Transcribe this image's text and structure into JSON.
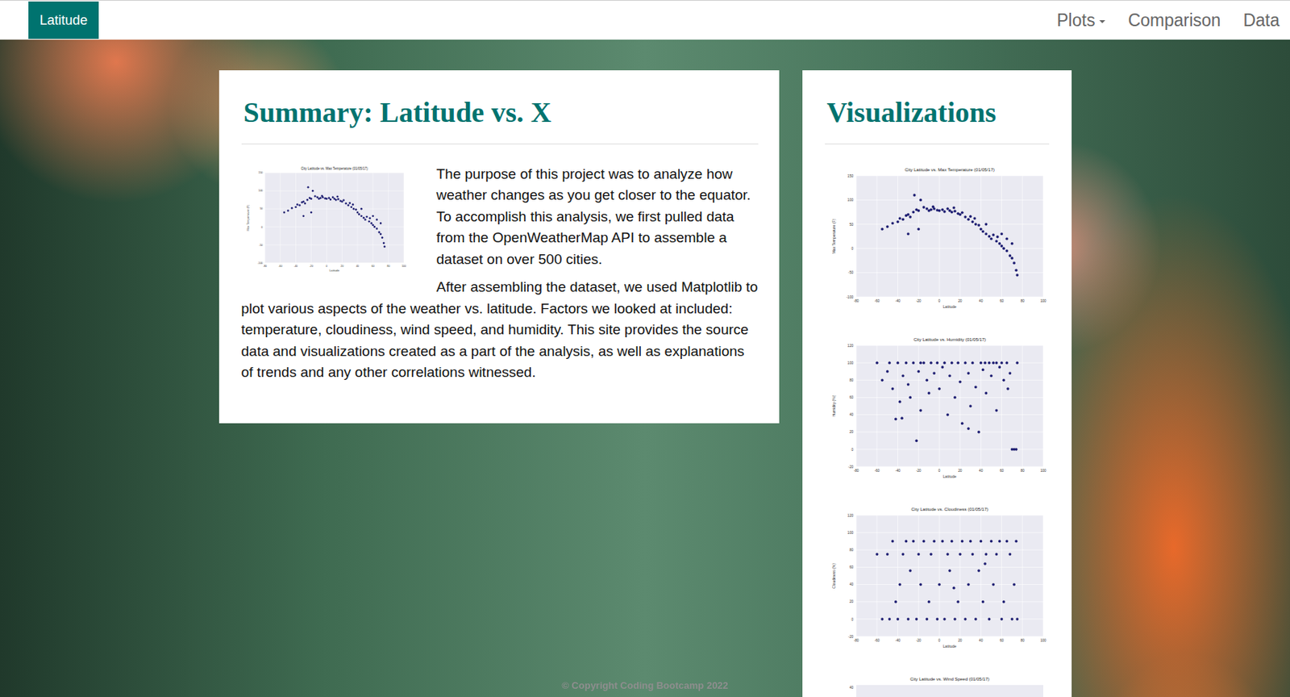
{
  "navbar": {
    "brand": "Latitude",
    "links": [
      {
        "label": "Plots",
        "dropdown": true
      },
      {
        "label": "Comparison",
        "dropdown": false
      },
      {
        "label": "Data",
        "dropdown": false
      }
    ]
  },
  "summary": {
    "title": "Summary: Latitude vs. X",
    "paragraphs": [
      "The purpose of this project was to analyze how weather changes as you get closer to the equator. To accomplish this analysis, we first pulled data from the OpenWeatherMap API to assemble a dataset on over 500 cities.",
      "After assembling the dataset, we used Matplotlib to plot various aspects of the weather vs. latitude. Factors we looked at included: temperature, cloudiness, wind speed, and humidity. This site provides the source data and visualizations created as a part of the analysis, as well as explanations of trends and any other correlations witnessed."
    ]
  },
  "visualizations": {
    "title": "Visualizations",
    "charts": [
      {
        "kind": "full",
        "title": "City Latitude vs. Max Temperature (01/05/17)",
        "x_label": "Latitude",
        "y_label": "Max Temperature (F)",
        "x_ticks": [
          "-80",
          "-60",
          "-40",
          "-20",
          "0",
          "20",
          "40",
          "60",
          "80",
          "100"
        ],
        "y_ticks": [
          "150",
          "100",
          "50",
          "0",
          "-50",
          "-100"
        ],
        "points": [
          [
            -55,
            40
          ],
          [
            -50,
            45
          ],
          [
            -45,
            52
          ],
          [
            -40,
            55
          ],
          [
            -38,
            62
          ],
          [
            -35,
            60
          ],
          [
            -32,
            68
          ],
          [
            -30,
            70
          ],
          [
            -28,
            65
          ],
          [
            -25,
            75
          ],
          [
            -22,
            80
          ],
          [
            -20,
            78
          ],
          [
            -18,
            100
          ],
          [
            -15,
            85
          ],
          [
            -12,
            82
          ],
          [
            -10,
            78
          ],
          [
            -8,
            80
          ],
          [
            -5,
            82
          ],
          [
            -2,
            79
          ],
          [
            0,
            78
          ],
          [
            3,
            80
          ],
          [
            5,
            76
          ],
          [
            8,
            82
          ],
          [
            10,
            78
          ],
          [
            12,
            75
          ],
          [
            15,
            77
          ],
          [
            18,
            72
          ],
          [
            20,
            70
          ],
          [
            22,
            74
          ],
          [
            25,
            65
          ],
          [
            28,
            60
          ],
          [
            30,
            66
          ],
          [
            32,
            55
          ],
          [
            35,
            50
          ],
          [
            38,
            48
          ],
          [
            40,
            40
          ],
          [
            42,
            35
          ],
          [
            45,
            30
          ],
          [
            48,
            25
          ],
          [
            50,
            20
          ],
          [
            52,
            28
          ],
          [
            55,
            15
          ],
          [
            58,
            10
          ],
          [
            60,
            5
          ],
          [
            62,
            0
          ],
          [
            65,
            -5
          ],
          [
            68,
            -15
          ],
          [
            70,
            10
          ],
          [
            72,
            -30
          ],
          [
            74,
            -45
          ],
          [
            75,
            -55
          ],
          [
            -30,
            30
          ],
          [
            -20,
            40
          ],
          [
            45,
            50
          ],
          [
            60,
            30
          ],
          [
            65,
            20
          ],
          [
            -24,
            110
          ],
          [
            -6,
            86
          ],
          [
            14,
            84
          ],
          [
            34,
            62
          ],
          [
            56,
            24
          ],
          [
            70,
            -20
          ]
        ]
      },
      {
        "kind": "full",
        "title": "City Latitude vs. Humidity (01/05/17)",
        "x_label": "Latitude",
        "y_label": "Humidity (%)",
        "x_ticks": [
          "-80",
          "-60",
          "-40",
          "-20",
          "0",
          "20",
          "40",
          "60",
          "80",
          "100"
        ],
        "y_ticks": [
          "120",
          "100",
          "80",
          "60",
          "40",
          "20",
          "0",
          "-20"
        ],
        "points": [
          [
            -55,
            80
          ],
          [
            -50,
            90
          ],
          [
            -45,
            70
          ],
          [
            -42,
            35
          ],
          [
            -40,
            100
          ],
          [
            -38,
            55
          ],
          [
            -35,
            85
          ],
          [
            -32,
            100
          ],
          [
            -30,
            75
          ],
          [
            -28,
            60
          ],
          [
            -25,
            100
          ],
          [
            -22,
            10
          ],
          [
            -20,
            90
          ],
          [
            -18,
            45
          ],
          [
            -15,
            100
          ],
          [
            -12,
            80
          ],
          [
            -10,
            65
          ],
          [
            -8,
            100
          ],
          [
            -5,
            88
          ],
          [
            -2,
            100
          ],
          [
            0,
            70
          ],
          [
            3,
            95
          ],
          [
            5,
            100
          ],
          [
            8,
            40
          ],
          [
            10,
            85
          ],
          [
            12,
            100
          ],
          [
            15,
            60
          ],
          [
            18,
            100
          ],
          [
            20,
            78
          ],
          [
            22,
            30
          ],
          [
            25,
            100
          ],
          [
            28,
            88
          ],
          [
            30,
            50
          ],
          [
            32,
            100
          ],
          [
            35,
            72
          ],
          [
            38,
            20
          ],
          [
            40,
            100
          ],
          [
            42,
            92
          ],
          [
            45,
            65
          ],
          [
            48,
            100
          ],
          [
            50,
            85
          ],
          [
            52,
            100
          ],
          [
            55,
            45
          ],
          [
            58,
            95
          ],
          [
            60,
            100
          ],
          [
            62,
            80
          ],
          [
            65,
            100
          ],
          [
            68,
            88
          ],
          [
            70,
            0
          ],
          [
            72,
            0
          ],
          [
            74,
            0
          ],
          [
            75,
            100
          ],
          [
            -48,
            100
          ],
          [
            -18,
            100
          ],
          [
            55,
            100
          ],
          [
            -60,
            100
          ],
          [
            -36,
            36
          ],
          [
            28,
            24
          ],
          [
            44,
            100
          ],
          [
            66,
            70
          ]
        ]
      },
      {
        "kind": "full",
        "title": "City Latitude vs. Cloudiness (01/05/17)",
        "x_label": "Latitude",
        "y_label": "Cloudiness (%)",
        "x_ticks": [
          "-80",
          "-60",
          "-40",
          "-20",
          "0",
          "20",
          "40",
          "60",
          "80",
          "100"
        ],
        "y_ticks": [
          "120",
          "100",
          "80",
          "60",
          "40",
          "20",
          "0",
          "-20"
        ],
        "points": [
          [
            -55,
            0
          ],
          [
            -50,
            75
          ],
          [
            -45,
            90
          ],
          [
            -42,
            20
          ],
          [
            -40,
            0
          ],
          [
            -38,
            40
          ],
          [
            -35,
            75
          ],
          [
            -32,
            90
          ],
          [
            -30,
            0
          ],
          [
            -28,
            56
          ],
          [
            -25,
            90
          ],
          [
            -22,
            0
          ],
          [
            -20,
            75
          ],
          [
            -18,
            40
          ],
          [
            -15,
            90
          ],
          [
            -12,
            0
          ],
          [
            -10,
            20
          ],
          [
            -8,
            75
          ],
          [
            -5,
            90
          ],
          [
            -2,
            0
          ],
          [
            0,
            40
          ],
          [
            3,
            90
          ],
          [
            5,
            0
          ],
          [
            8,
            75
          ],
          [
            10,
            56
          ],
          [
            12,
            90
          ],
          [
            15,
            0
          ],
          [
            18,
            20
          ],
          [
            20,
            75
          ],
          [
            22,
            90
          ],
          [
            25,
            0
          ],
          [
            28,
            40
          ],
          [
            30,
            90
          ],
          [
            32,
            75
          ],
          [
            35,
            0
          ],
          [
            38,
            56
          ],
          [
            40,
            90
          ],
          [
            42,
            20
          ],
          [
            45,
            75
          ],
          [
            48,
            0
          ],
          [
            50,
            90
          ],
          [
            52,
            40
          ],
          [
            55,
            75
          ],
          [
            58,
            90
          ],
          [
            60,
            0
          ],
          [
            62,
            20
          ],
          [
            65,
            90
          ],
          [
            68,
            75
          ],
          [
            70,
            0
          ],
          [
            72,
            40
          ],
          [
            74,
            90
          ],
          [
            75,
            0
          ],
          [
            -60,
            75
          ],
          [
            -48,
            0
          ],
          [
            14,
            36
          ],
          [
            44,
            64
          ]
        ]
      },
      {
        "kind": "partial",
        "title": "City Latitude vs. Wind Speed (01/05/17)",
        "y_ticks": [
          "40"
        ]
      }
    ]
  },
  "footer": "© Copyright Coding Bootcamp 2022"
}
